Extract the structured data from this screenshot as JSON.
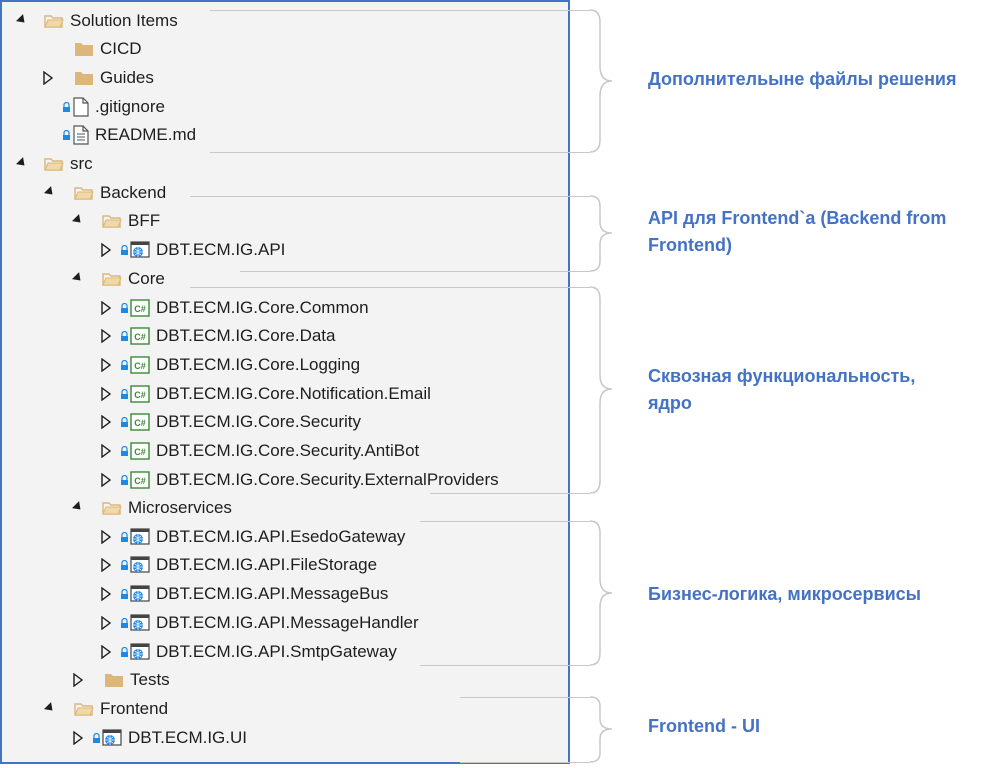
{
  "tree": [
    {
      "label": "Solution Items",
      "expander": "open",
      "icon": "folder-open"
    },
    {
      "label": "CICD",
      "expander": "none",
      "icon": "folder"
    },
    {
      "label": "Guides",
      "expander": "closed",
      "icon": "folder"
    },
    {
      "label": ".gitignore",
      "expander": "none",
      "icon": "file",
      "lock": true
    },
    {
      "label": "README.md",
      "expander": "none",
      "icon": "file-text",
      "lock": true
    },
    {
      "label": "src",
      "expander": "open",
      "icon": "folder-open"
    },
    {
      "label": "Backend",
      "expander": "open",
      "icon": "folder-open"
    },
    {
      "label": "BFF",
      "expander": "open",
      "icon": "folder-open"
    },
    {
      "label": "DBT.ECM.IG.API",
      "expander": "closed",
      "icon": "web-project",
      "lock": true
    },
    {
      "label": "Core",
      "expander": "open",
      "icon": "folder-open"
    },
    {
      "label": "DBT.ECM.IG.Core.Common",
      "expander": "closed",
      "icon": "csharp-project",
      "lock": true
    },
    {
      "label": "DBT.ECM.IG.Core.Data",
      "expander": "closed",
      "icon": "csharp-project",
      "lock": true
    },
    {
      "label": "DBT.ECM.IG.Core.Logging",
      "expander": "closed",
      "icon": "csharp-project",
      "lock": true
    },
    {
      "label": "DBT.ECM.IG.Core.Notification.Email",
      "expander": "closed",
      "icon": "csharp-project",
      "lock": true
    },
    {
      "label": "DBT.ECM.IG.Core.Security",
      "expander": "closed",
      "icon": "csharp-project",
      "lock": true
    },
    {
      "label": "DBT.ECM.IG.Core.Security.AntiBot",
      "expander": "closed",
      "icon": "csharp-project",
      "lock": true
    },
    {
      "label": "DBT.ECM.IG.Core.Security.ExternalProviders",
      "expander": "closed",
      "icon": "csharp-project",
      "lock": true
    },
    {
      "label": "Microservices",
      "expander": "open",
      "icon": "folder-open"
    },
    {
      "label": "DBT.ECM.IG.API.EsedoGateway",
      "expander": "closed",
      "icon": "web-project",
      "lock": true
    },
    {
      "label": "DBT.ECM.IG.API.FileStorage",
      "expander": "closed",
      "icon": "web-project",
      "lock": true
    },
    {
      "label": "DBT.ECM.IG.API.MessageBus",
      "expander": "closed",
      "icon": "web-project",
      "lock": true
    },
    {
      "label": "DBT.ECM.IG.API.MessageHandler",
      "expander": "closed",
      "icon": "web-project",
      "lock": true
    },
    {
      "label": "DBT.ECM.IG.API.SmtpGateway",
      "expander": "closed",
      "icon": "web-project",
      "lock": true
    },
    {
      "label": "Tests",
      "expander": "closed",
      "icon": "folder"
    },
    {
      "label": "Frontend",
      "expander": "open",
      "icon": "folder-open"
    },
    {
      "label": "DBT.ECM.IG.UI",
      "expander": "closed",
      "icon": "web-project",
      "lock": true
    }
  ],
  "annotations": {
    "solution_files": "Дополнительыне файлы решения",
    "bff_line1": "API для Frontend`a (Backend from",
    "bff_line2": "Frontend)",
    "core_line1": "Сквозная функциональность,",
    "core_line2": "ядро",
    "microservices": "Бизнес-логика, микросервисы",
    "frontend": "Frontend - UI"
  },
  "colors": {
    "accent": "#4472c4",
    "tree_bg": "#f3f3f3",
    "folder": "#dcb67a",
    "csharp": "#388a34",
    "lock": "#1e88e5"
  }
}
